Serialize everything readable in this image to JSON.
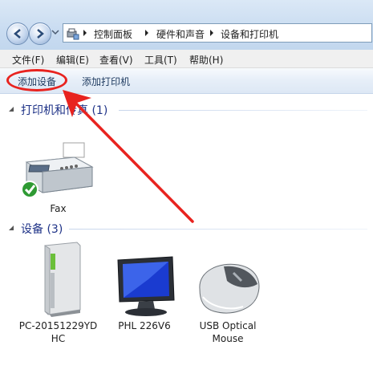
{
  "breadcrumb": {
    "items": [
      "控制面板",
      "硬件和声音",
      "设备和打印机"
    ]
  },
  "menu": [
    "文件(F)",
    "编辑(E)",
    "查看(V)",
    "工具(T)",
    "帮助(H)"
  ],
  "commands": {
    "add_device": "添加设备",
    "add_printer": "添加打印机"
  },
  "sections": {
    "printers": {
      "title": "打印机和传真 (1)",
      "items": [
        {
          "name": "Fax"
        }
      ]
    },
    "devices": {
      "title": "设备 (3)",
      "items": [
        {
          "name_line1": "PC-20151229YD",
          "name_line2": "HC"
        },
        {
          "name_line1": "PHL 226V6",
          "name_line2": ""
        },
        {
          "name_line1": "USB Optical",
          "name_line2": "Mouse"
        }
      ]
    }
  },
  "annotation_color": "#e8231f"
}
